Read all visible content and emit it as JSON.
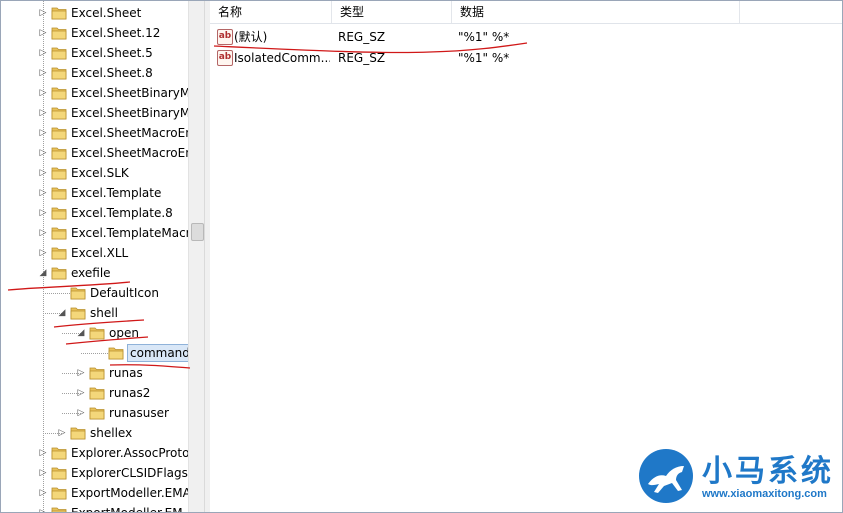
{
  "tree": {
    "items": [
      {
        "label": "Excel.Sheet",
        "level": 0,
        "expander": "collapsed"
      },
      {
        "label": "Excel.Sheet.12",
        "level": 0,
        "expander": "collapsed"
      },
      {
        "label": "Excel.Sheet.5",
        "level": 0,
        "expander": "collapsed"
      },
      {
        "label": "Excel.Sheet.8",
        "level": 0,
        "expander": "collapsed"
      },
      {
        "label": "Excel.SheetBinaryMa",
        "level": 0,
        "expander": "collapsed"
      },
      {
        "label": "Excel.SheetBinaryMa",
        "level": 0,
        "expander": "collapsed"
      },
      {
        "label": "Excel.SheetMacroEn",
        "level": 0,
        "expander": "collapsed"
      },
      {
        "label": "Excel.SheetMacroEn",
        "level": 0,
        "expander": "collapsed"
      },
      {
        "label": "Excel.SLK",
        "level": 0,
        "expander": "collapsed"
      },
      {
        "label": "Excel.Template",
        "level": 0,
        "expander": "collapsed"
      },
      {
        "label": "Excel.Template.8",
        "level": 0,
        "expander": "collapsed"
      },
      {
        "label": "Excel.TemplateMacr",
        "level": 0,
        "expander": "collapsed"
      },
      {
        "label": "Excel.XLL",
        "level": 0,
        "expander": "collapsed"
      },
      {
        "label": "exefile",
        "level": 0,
        "expander": "expanded"
      },
      {
        "label": "DefaultIcon",
        "level": 1,
        "expander": "none"
      },
      {
        "label": "shell",
        "level": 1,
        "expander": "expanded"
      },
      {
        "label": "open",
        "level": 2,
        "expander": "expanded"
      },
      {
        "label": "command",
        "level": 3,
        "expander": "none",
        "selected": true
      },
      {
        "label": "runas",
        "level": 2,
        "expander": "collapsed"
      },
      {
        "label": "runas2",
        "level": 2,
        "expander": "collapsed"
      },
      {
        "label": "runasuser",
        "level": 2,
        "expander": "collapsed"
      },
      {
        "label": "shellex",
        "level": 1,
        "expander": "collapsed"
      },
      {
        "label": "Explorer.AssocProto",
        "level": 0,
        "expander": "collapsed"
      },
      {
        "label": "ExplorerCLSIDFlags",
        "level": 0,
        "expander": "collapsed"
      },
      {
        "label": "ExportModeller.EMA",
        "level": 0,
        "expander": "collapsed"
      },
      {
        "label": "ExportModeller.EM",
        "level": 0,
        "expander": "collapsed"
      }
    ]
  },
  "list": {
    "columns": {
      "name": "名称",
      "type": "类型",
      "data": "数据"
    },
    "rows": [
      {
        "icon": "string-value-icon",
        "icon_text": "ab",
        "name": "(默认)",
        "type": "REG_SZ",
        "data": "\"%1\" %*"
      },
      {
        "icon": "string-value-icon",
        "icon_text": "ab",
        "name": "IsolatedComm...",
        "type": "REG_SZ",
        "data": "\"%1\" %*"
      }
    ]
  },
  "watermark": {
    "title": "小马系统",
    "url": "www.xiaomaxitong.com"
  },
  "colors": {
    "folder": "#e8c15a",
    "selection": "#d9e7f7",
    "pen": "#d01818",
    "watermark": "#1f78c8"
  }
}
